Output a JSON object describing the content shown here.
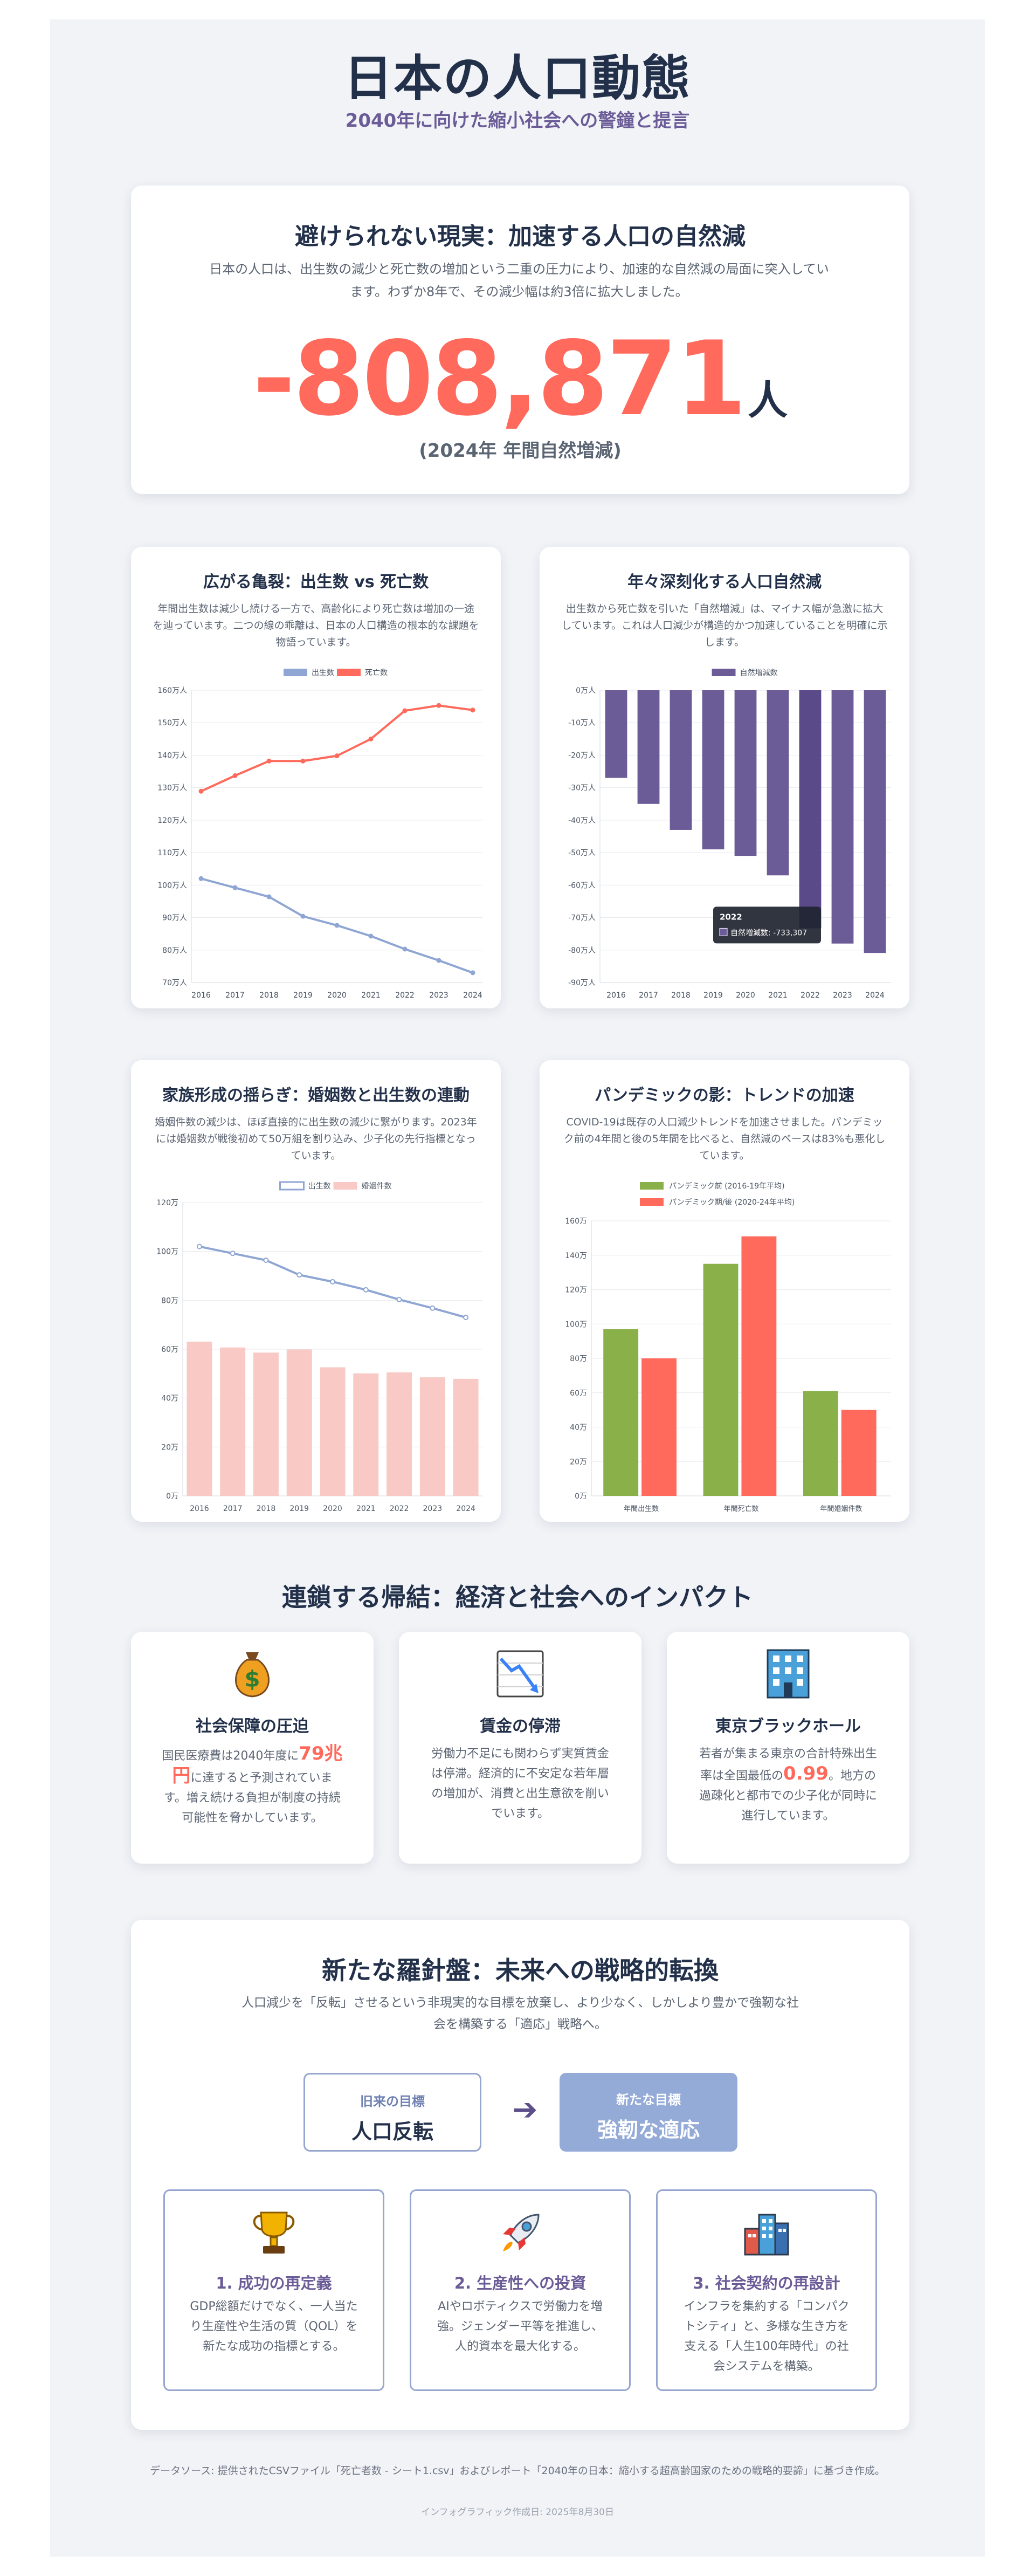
{
  "header": {
    "title": "日本の人口動態",
    "subtitle": "2040年に向けた縮小社会への警鐘と提言"
  },
  "hero": {
    "title": "避けられない現実：加速する人口の自然減",
    "description": "日本の人口は、出生数の減少と死亡数の増加という二重の圧力により、加速的な自然減の局面に突入しています。わずか8年で、その減少幅は約3倍に拡大しました。",
    "value": "-808,871",
    "unit": "人",
    "note": "(2024年 年間自然増減)"
  },
  "charts": {
    "births_deaths": {
      "title": "広がる亀裂：出生数 vs 死亡数",
      "description": "年間出生数は減少し続ける一方で、高齢化により死亡数は増加の一途を辿っています。二つの線の乖離は、日本の人口構造の根本的な課題を物語っています。"
    },
    "natural_change": {
      "title": "年々深刻化する人口自然減",
      "description": "出生数から死亡数を引いた「自然増減」は、マイナス幅が急激に拡大しています。これは人口減少が構造的かつ加速していることを明確に示します。",
      "tooltip_title": "2022",
      "tooltip_label": "自然増減数: -733,307"
    },
    "marriages_births": {
      "title": "家族形成の揺らぎ：婚姻数と出生数の連動",
      "description": "婚姻件数の減少は、ほぼ直接的に出生数の減少に繋がります。2023年には婚姻数が戦後初めて50万組を割り込み、少子化の先行指標となっています。"
    },
    "pandemic": {
      "title": "パンデミックの影：トレンドの加速",
      "description": "COVID-19は既存の人口減少トレンドを加速させました。パンデミック前の4年間と後の5年間を比べると、自然減のペースは83%も悪化しています。"
    }
  },
  "chart_data": [
    {
      "type": "line",
      "title": "広がる亀裂：出生数 vs 死亡数",
      "x": [
        "2016",
        "2017",
        "2018",
        "2019",
        "2020",
        "2021",
        "2022",
        "2023",
        "2024"
      ],
      "series": [
        {
          "name": "出生数",
          "color": "#8fa6d4",
          "values": [
            102.0,
            99.2,
            96.4,
            90.4,
            87.6,
            84.3,
            80.3,
            76.8,
            73.0
          ]
        },
        {
          "name": "死亡数",
          "color": "#ff6a5c",
          "values": [
            128.9,
            133.7,
            138.2,
            138.2,
            139.8,
            145.0,
            153.7,
            155.3,
            153.9
          ]
        }
      ],
      "ylim": [
        70,
        160
      ],
      "yticks": [
        "70万人",
        "80万人",
        "90万人",
        "100万人",
        "110万人",
        "120万人",
        "130万人",
        "140万人",
        "150万人",
        "160万人"
      ],
      "ytick_values": [
        70,
        80,
        90,
        100,
        110,
        120,
        130,
        140,
        150,
        160
      ],
      "legend": "top"
    },
    {
      "type": "bar",
      "title": "年々深刻化する人口自然減",
      "categories": [
        "2016",
        "2017",
        "2018",
        "2019",
        "2020",
        "2021",
        "2022",
        "2023",
        "2024"
      ],
      "series": [
        {
          "name": "自然増減数",
          "color": "#6b5c97",
          "values": [
            -27.0,
            -35.0,
            -43.0,
            -49.0,
            -51.0,
            -57.0,
            -73.3,
            -78.0,
            -80.9
          ]
        }
      ],
      "ylim": [
        -90,
        0
      ],
      "yticks": [
        "0万人",
        "-10万人",
        "-20万人",
        "-30万人",
        "-40万人",
        "-50万人",
        "-60万人",
        "-70万人",
        "-80万人",
        "-90万人"
      ],
      "ytick_values": [
        0,
        -10,
        -20,
        -30,
        -40,
        -50,
        -60,
        -70,
        -80,
        -90
      ],
      "highlight_index": 6,
      "legend": "top"
    },
    {
      "type": "bar",
      "title": "家族形成の揺らぎ：婚姻数と出生数の連動",
      "categories": [
        "2016",
        "2017",
        "2018",
        "2019",
        "2020",
        "2021",
        "2022",
        "2023",
        "2024"
      ],
      "series": [
        {
          "name": "出生数",
          "kind": "line",
          "color": "#8fa6d4",
          "values": [
            102.0,
            99.2,
            96.4,
            90.4,
            87.6,
            84.3,
            80.3,
            76.8,
            73.0
          ]
        },
        {
          "name": "婚姻件数",
          "kind": "bar",
          "color": "#f8c9c5",
          "values": [
            63.1,
            60.7,
            58.6,
            59.9,
            52.6,
            50.1,
            50.5,
            48.5,
            47.9
          ]
        }
      ],
      "ylim": [
        0,
        120
      ],
      "yticks": [
        "0万",
        "20万",
        "40万",
        "60万",
        "80万",
        "100万",
        "120万"
      ],
      "ytick_values": [
        0,
        20,
        40,
        60,
        80,
        100,
        120
      ],
      "legend": "top"
    },
    {
      "type": "bar",
      "title": "パンデミックの影：トレンドの加速",
      "categories": [
        "年間出生数",
        "年間死亡数",
        "年間婚姻件数"
      ],
      "series": [
        {
          "name": "パンデミック前 (2016-19年平均)",
          "color": "#8ab04a",
          "values": [
            97,
            135,
            61
          ]
        },
        {
          "name": "パンデミック期/後 (2020-24年平均)",
          "color": "#ff6a5c",
          "values": [
            80,
            151,
            50
          ]
        }
      ],
      "ylim": [
        0,
        160
      ],
      "yticks": [
        "0万",
        "20万",
        "40万",
        "60万",
        "80万",
        "100万",
        "120万",
        "140万",
        "160万"
      ],
      "ytick_values": [
        0,
        20,
        40,
        60,
        80,
        100,
        120,
        140,
        160
      ],
      "legend": "top"
    }
  ],
  "impact": {
    "section_title": "連鎖する帰結：経済と社会へのインパクト",
    "cards": [
      {
        "icon": "money-bag-icon",
        "title": "社会保障の圧迫",
        "text_before": "国民医療費は2040年度に",
        "highlight": "79兆円",
        "text_after": "に達すると予測されています。増え続ける負担が制度の持続可能性を脅かしています。"
      },
      {
        "icon": "chart-decreasing-icon",
        "title": "賃金の停滞",
        "text_before": "労働力不足にも関わらず実質賃金は停滞。経済的に不安定な若年層の増加が、消費と出生意欲を削いでいます。",
        "highlight": "",
        "text_after": ""
      },
      {
        "icon": "office-building-icon",
        "title": "東京ブラックホール",
        "text_before": "若者が集まる東京の合計特殊出生率は全国最低の",
        "highlight": "0.99",
        "text_after": "。地方の過疎化と都市での少子化が同時に進行しています。"
      }
    ]
  },
  "strategy": {
    "title": "新たな羅針盤：未来への戦略的転換",
    "description": "人口減少を「反転」させるという非現実的な目標を放棄し、より少なく、しかしより豊かで強靭な社会を構築する「適応」戦略へ。",
    "old_goal_label": "旧来の目標",
    "old_goal_value": "人口反転",
    "arrow": "➔",
    "new_goal_label": "新たな目標",
    "new_goal_value": "強靭な適応",
    "pillars": [
      {
        "icon": "trophy-icon",
        "title": "1. 成功の再定義",
        "text": "GDP総額だけでなく、一人当たり生産性や生活の質（QOL）を新たな成功の指標とする。"
      },
      {
        "icon": "rocket-icon",
        "title": "2. 生産性への投資",
        "text": "AIやロボティクスで労働力を増強。ジェンダー平等を推進し、人的資本を最大化する。"
      },
      {
        "icon": "city-buildings-icon",
        "title": "3. 社会契約の再設計",
        "text": "インフラを集約する「コンパクトシティ」と、多様な生き方を支える「人生100年時代」の社会システムを構築。"
      }
    ]
  },
  "footer": {
    "source": "データソース: 提供されたCSVファイル「死亡者数 - シート1.csv」およびレポート「2040年の日本：縮小する超高齢国家のための戦略的要諦」に基づき作成。",
    "created": "インフォグラフィック作成日: 2025年8月30日"
  },
  "colors": {
    "accent_red": "#ff6a5c",
    "accent_purple": "#6b5c97",
    "accent_blue": "#8fa6d4",
    "accent_green": "#8ab04a",
    "pink": "#f8c9c5",
    "navy": "#22304a"
  }
}
